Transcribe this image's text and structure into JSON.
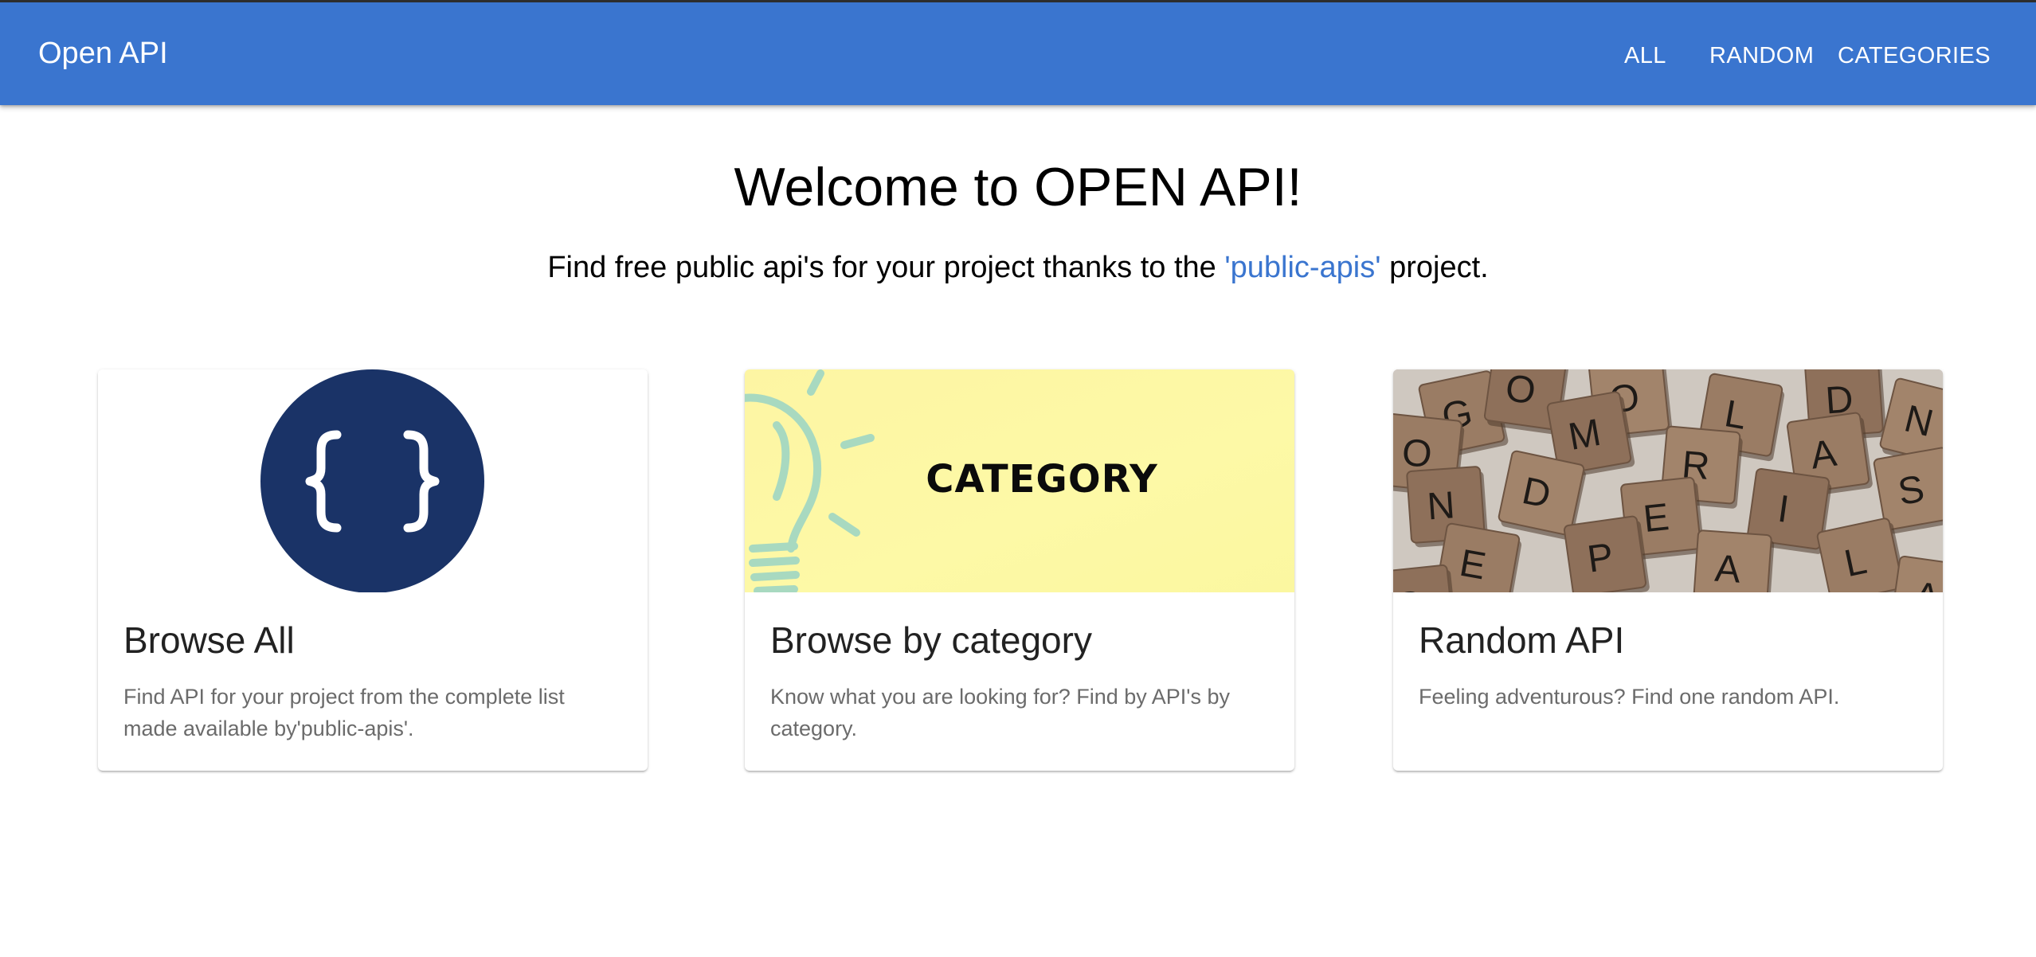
{
  "header": {
    "brand": "Open API",
    "nav": {
      "all": "ALL",
      "random": "RANDOM",
      "categories": "CATEGORIES"
    }
  },
  "hero": {
    "title": "Welcome to OPEN API!",
    "subtitle_before": "Find free public api's for your project thanks to the ",
    "subtitle_link": "'public-apis'",
    "subtitle_after": " project."
  },
  "cards": [
    {
      "title": "Browse All",
      "description": "Find API for your project from the complete list made available by'public-apis'.",
      "image_icon": "curly-braces-icon"
    },
    {
      "title": "Browse by category",
      "description": "Know what you are looking for? Find by API's by category.",
      "image_text": "CATEGORY",
      "image_icon": "lightbulb-icon"
    },
    {
      "title": "Random API",
      "description": "Feeling adventurous? Find one random API.",
      "image_icon": "scrabble-tiles-image",
      "tiles": [
        "G",
        "O",
        "O",
        "L",
        "D",
        "N",
        "O",
        "M",
        "R",
        "A",
        "N",
        "D",
        "E",
        "I",
        "S",
        "E",
        "P",
        "A",
        "L",
        "S",
        "A"
      ]
    }
  ],
  "colors": {
    "appbar": "#3a75cf",
    "link": "#3a75cf",
    "braces_circle": "#1a3367",
    "category_banner": "#fdf7a4"
  }
}
